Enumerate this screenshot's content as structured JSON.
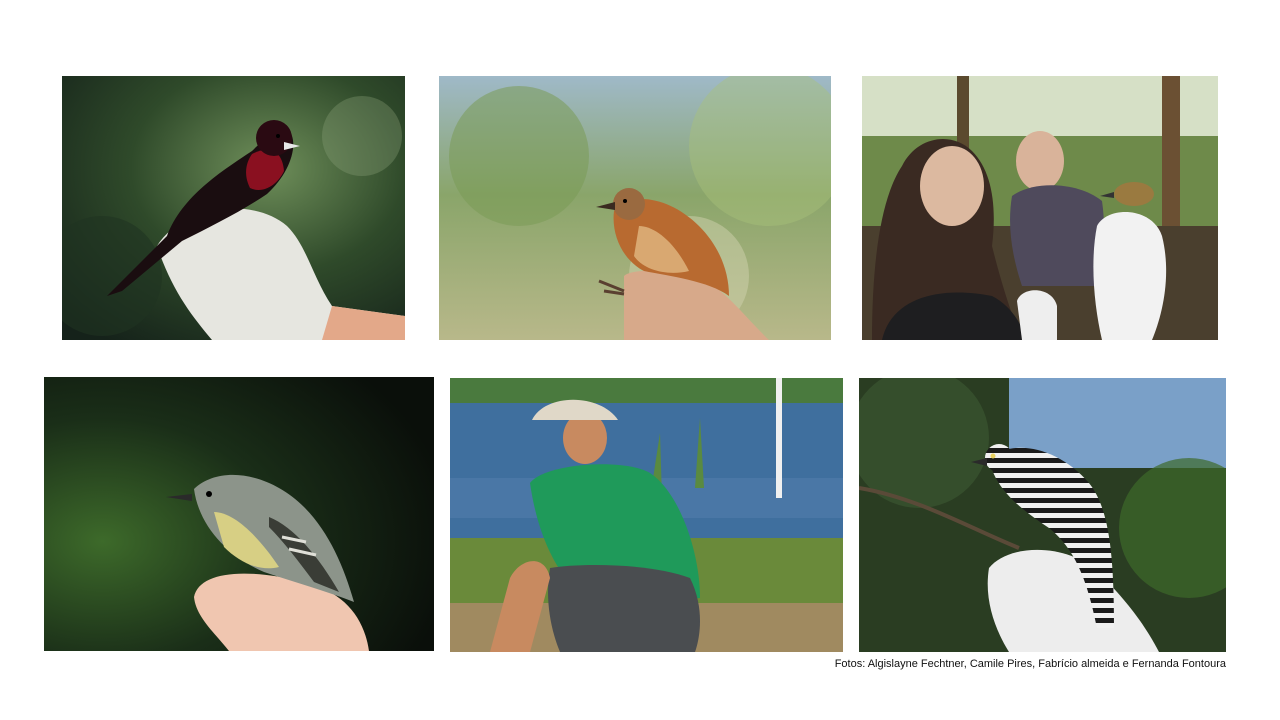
{
  "slide": {
    "photos": [
      {
        "subject": "red-throated black bird on gloved hand"
      },
      {
        "subject": "brown bird perched on finger"
      },
      {
        "subject": "two researchers with small bird"
      },
      {
        "subject": "grey flycatcher held in hand"
      },
      {
        "subject": "man in green shirt crouching by water"
      },
      {
        "subject": "barred antshrike held in gloved hand"
      }
    ],
    "credit": "Fotos: Algislayne Fechtner, Camile Pires, Fabrício almeida e Fernanda Fontoura"
  }
}
